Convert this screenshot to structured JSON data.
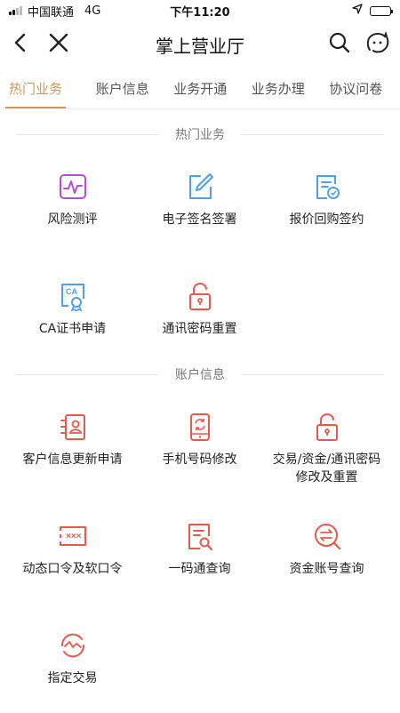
{
  "status_bar": {
    "carrier": "中国联通",
    "network": "4G",
    "time": "下午11:20",
    "battery_level": 0.9
  },
  "nav": {
    "title": "掌上营业厅"
  },
  "tabs": [
    {
      "label": "热门业务"
    },
    {
      "label": "账户信息"
    },
    {
      "label": "业务开通"
    },
    {
      "label": "业务办理"
    },
    {
      "label": "协议问卷"
    }
  ],
  "sections": {
    "hot": {
      "title": "热门业务",
      "items": [
        {
          "label": "风险测评",
          "icon": "risk-chart-icon"
        },
        {
          "label": "电子签名签署",
          "icon": "pen-signature-icon"
        },
        {
          "label": "报价回购签约",
          "icon": "contract-document-icon"
        },
        {
          "label": "CA证书申请",
          "icon": "certificate-icon"
        },
        {
          "label": "通讯密码重置",
          "icon": "unlock-icon"
        }
      ]
    },
    "account": {
      "title": "账户信息",
      "items": [
        {
          "label": "客户信息更新申请",
          "icon": "profile-card-icon"
        },
        {
          "label": "手机号码修改",
          "icon": "phone-icon"
        },
        {
          "label": "交易/资金/通讯密码修改及重置",
          "icon": "unlock-icon"
        },
        {
          "label": "动态口令及软口令",
          "icon": "password-box-icon"
        },
        {
          "label": "一码通查询",
          "icon": "doc-search-icon"
        },
        {
          "label": "资金账号查询",
          "icon": "exchange-search-icon"
        },
        {
          "label": "指定交易",
          "icon": "trade-icon"
        }
      ]
    }
  },
  "colors": {
    "accent": "#c99a5a",
    "icon_red": "#e8584c",
    "icon_purple": "#b34fd6",
    "icon_blue": "#4fa0e8"
  }
}
